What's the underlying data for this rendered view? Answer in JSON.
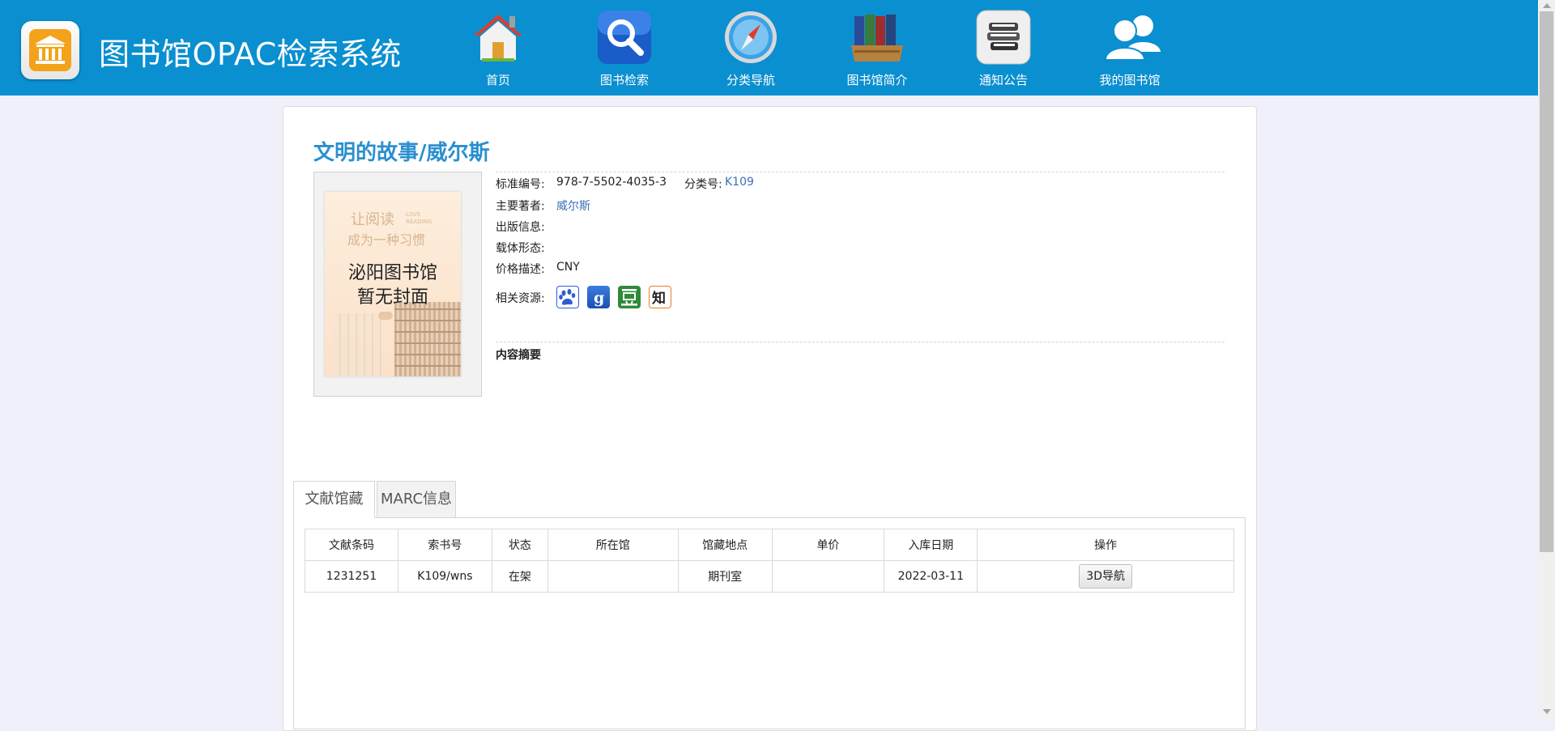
{
  "header": {
    "site_title": "图书馆OPAC检索系统",
    "nav": [
      {
        "label": "首页",
        "icon": "home-icon"
      },
      {
        "label": "图书检索",
        "icon": "search-icon"
      },
      {
        "label": "分类导航",
        "icon": "compass-icon"
      },
      {
        "label": "图书馆简介",
        "icon": "books-icon"
      },
      {
        "label": "通知公告",
        "icon": "notice-icon"
      },
      {
        "label": "我的图书馆",
        "icon": "users-icon"
      }
    ]
  },
  "book": {
    "title": "文明的故事/威尔斯",
    "cover": {
      "slogan1": "让阅读",
      "slogan2": "成为一种习惯",
      "slogan_en": "LOVE READING",
      "library": "泌阳图书馆",
      "no_cover": "暂无封面"
    },
    "fields": {
      "isbn_label": "标准编号:",
      "isbn": "978-7-5502-4035-3",
      "class_label": "分类号:",
      "class_no": "K109",
      "author_label": "主要著者:",
      "author": "威尔斯",
      "publish_label": "出版信息:",
      "publish": "",
      "carrier_label": "载体形态:",
      "carrier": "",
      "price_label": "价格描述:",
      "price": "CNY",
      "resources_label": "相关资源:"
    },
    "resources": [
      "baidu-icon",
      "google-icon",
      "douban-icon",
      "zhihu-icon"
    ],
    "abstract_label": "内容摘要"
  },
  "tabs": [
    {
      "label": "文献馆藏",
      "active": true
    },
    {
      "label": "MARC信息",
      "active": false
    }
  ],
  "holdings": {
    "columns": [
      "文献条码",
      "索书号",
      "状态",
      "所在馆",
      "馆藏地点",
      "单价",
      "入库日期",
      "操作"
    ],
    "rows": [
      {
        "barcode": "1231251",
        "callno": "K109/wns",
        "status": "在架",
        "library": "",
        "location": "期刊室",
        "price": "",
        "date": "2022-03-11",
        "action": "3D导航"
      }
    ]
  },
  "colors": {
    "header_bg": "#0a8fd0",
    "title_blue": "#2a8fd0",
    "link_blue": "#3a70b8",
    "page_bg": "#f0f0fa"
  }
}
